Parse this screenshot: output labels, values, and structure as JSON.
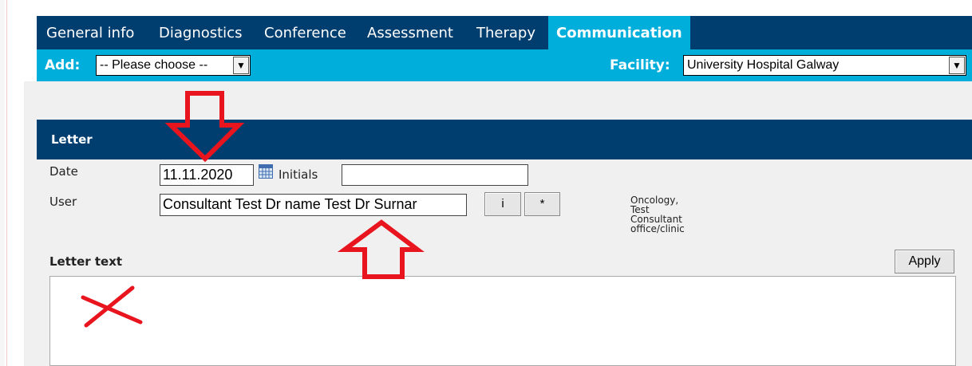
{
  "tabs": [
    {
      "label": "General info",
      "active": false
    },
    {
      "label": "Diagnostics",
      "active": false
    },
    {
      "label": "Conference",
      "active": false
    },
    {
      "label": "Assessment",
      "active": false
    },
    {
      "label": "Therapy",
      "active": false
    },
    {
      "label": "Communication",
      "active": true
    }
  ],
  "toolbar": {
    "add_label": "Add:",
    "add_select_value": "-- Please choose --",
    "facility_label": "Facility:",
    "facility_select_value": "University Hospital Galway"
  },
  "letter": {
    "title": "Letter",
    "date_label": "Date",
    "date_value": "11.11.2020",
    "initials_label": "Initials",
    "initials_value": "",
    "user_label": "User",
    "user_value": "Consultant  Test Dr name  Test Dr Surnar",
    "info_button_label": "i",
    "star_button_label": "*",
    "user_info_lines": [
      "Oncology,",
      "Test",
      "Consultant",
      "office/clinic"
    ],
    "letter_text_label": "Letter text",
    "apply_label": "Apply",
    "letter_text_value": ""
  },
  "colors": {
    "navy": "#003e6f",
    "cyan": "#00aedc",
    "annotation_red": "#e8141e",
    "panel_grey": "#f0f0f0"
  },
  "annotations": [
    "down-arrow-marker",
    "up-arrow-marker",
    "cross-marker"
  ]
}
